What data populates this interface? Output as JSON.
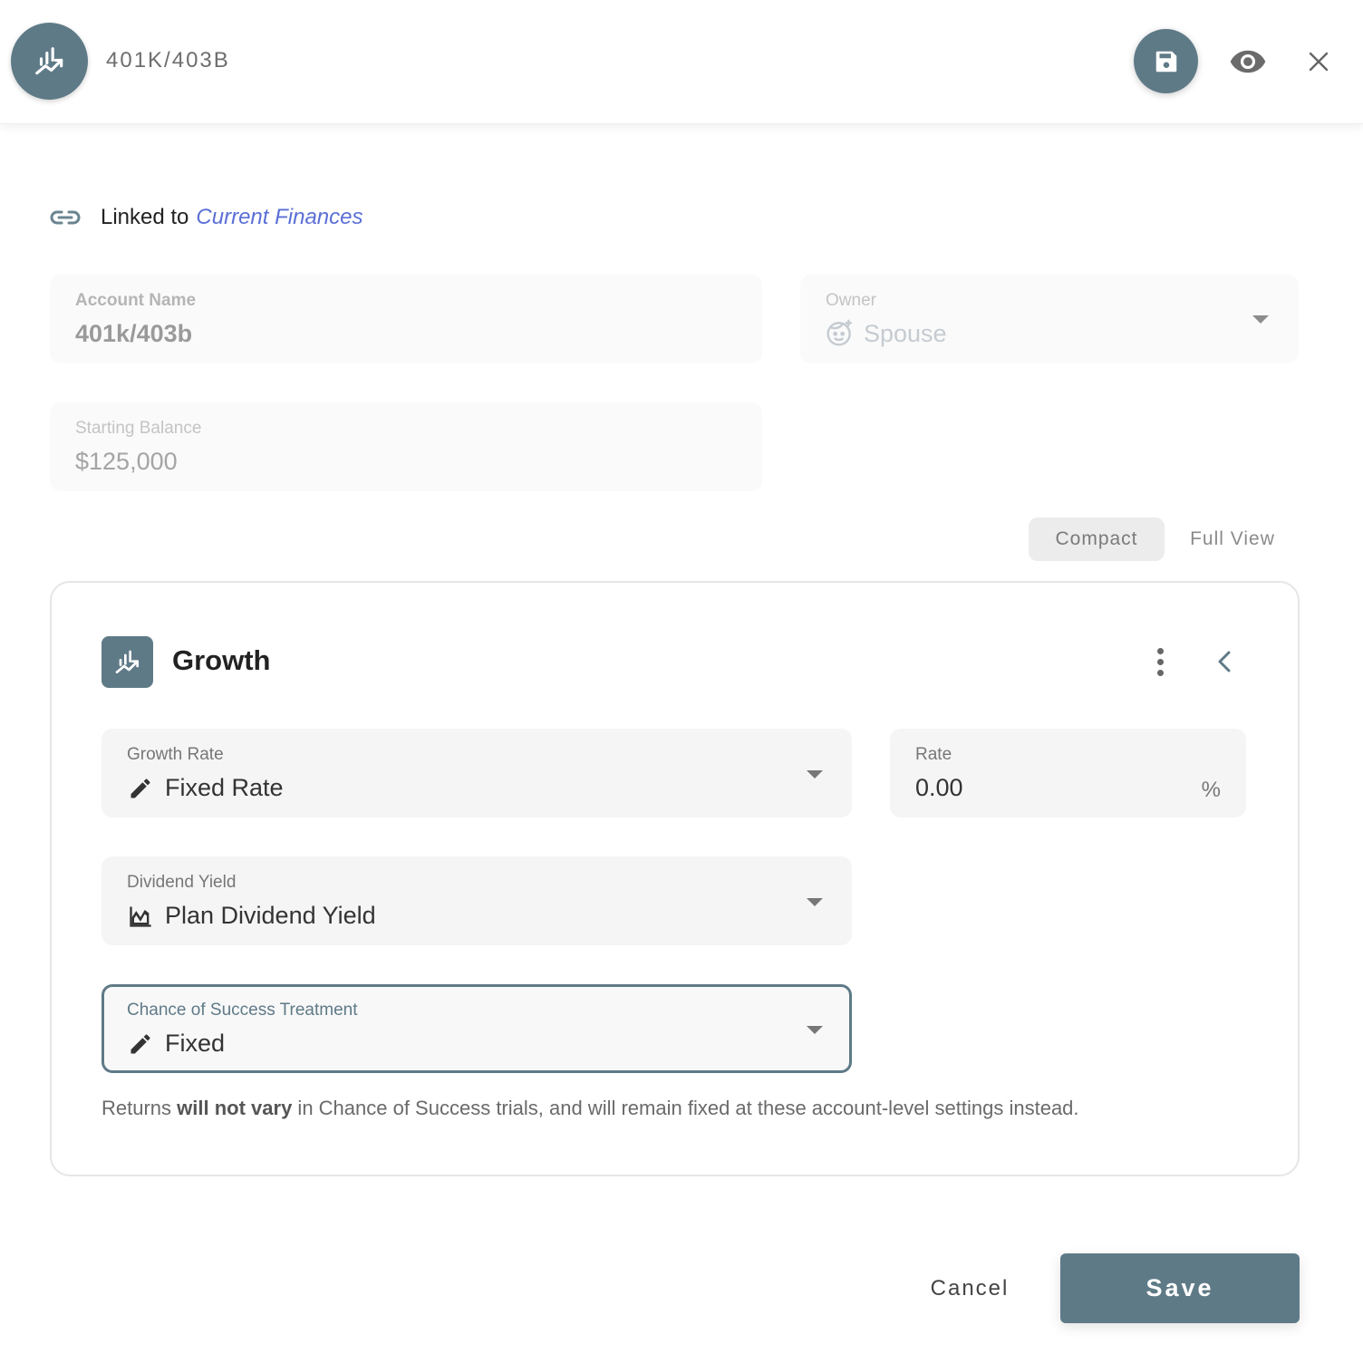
{
  "header": {
    "title": "401K/403B",
    "avatar_icon": "chart-growth-icon",
    "actions": [
      {
        "name": "save",
        "icon": "floppy-disk-icon"
      },
      {
        "name": "preview",
        "icon": "eye-icon"
      },
      {
        "name": "close",
        "icon": "close-icon"
      }
    ]
  },
  "linked": {
    "icon": "link-icon",
    "prefix": "Linked to",
    "target": "Current Finances"
  },
  "fields": {
    "account_name": {
      "label": "Account Name",
      "value": "401k/403b"
    },
    "owner": {
      "label": "Owner",
      "value": "Spouse",
      "icon": "face-icon"
    },
    "starting_balance": {
      "label": "Starting Balance",
      "value": "$125,000"
    }
  },
  "view_toggle": {
    "options": [
      "Compact",
      "Full View"
    ],
    "selected": "Compact"
  },
  "growth_card": {
    "title": "Growth",
    "icon": "chart-growth-icon",
    "growth_rate": {
      "label": "Growth Rate",
      "value": "Fixed Rate",
      "icon": "pencil-icon"
    },
    "rate": {
      "label": "Rate",
      "value": "0.00",
      "suffix": "%"
    },
    "dividend_yield": {
      "label": "Dividend Yield",
      "value": "Plan Dividend Yield",
      "icon": "area-chart-icon"
    },
    "chance_of_success": {
      "label": "Chance of Success Treatment",
      "value": "Fixed",
      "icon": "pencil-icon"
    },
    "helper": {
      "pre": "Returns ",
      "bold": "will not vary",
      "post": " in Chance of Success trials, and will remain fixed at these account-level settings instead."
    }
  },
  "footer": {
    "cancel_label": "Cancel",
    "save_label": "Save"
  },
  "colors": {
    "primary": "#5f7a87",
    "link": "#5b6fd6"
  }
}
